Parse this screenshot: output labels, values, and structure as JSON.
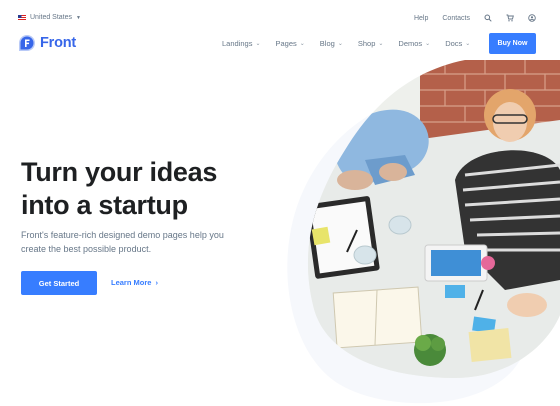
{
  "topbar": {
    "locale": "United States",
    "help": "Help",
    "contacts": "Contacts",
    "icons": [
      "search-icon",
      "cart-icon",
      "user-icon"
    ]
  },
  "brand": {
    "name": "Front",
    "color": "#3766e9"
  },
  "nav": {
    "items": [
      {
        "label": "Landings"
      },
      {
        "label": "Pages"
      },
      {
        "label": "Blog"
      },
      {
        "label": "Shop"
      },
      {
        "label": "Demos"
      },
      {
        "label": "Docs"
      }
    ],
    "cta": "Buy Now"
  },
  "hero": {
    "title_line1": "Turn your ideas",
    "title_line2": "into a startup",
    "subtitle": "Front's feature-rich designed demo pages help you create the best possible product.",
    "primary_button": "Get Started",
    "secondary_link": "Learn More"
  },
  "colors": {
    "accent": "#377dff",
    "text": "#1e2022",
    "muted": "#677788"
  }
}
